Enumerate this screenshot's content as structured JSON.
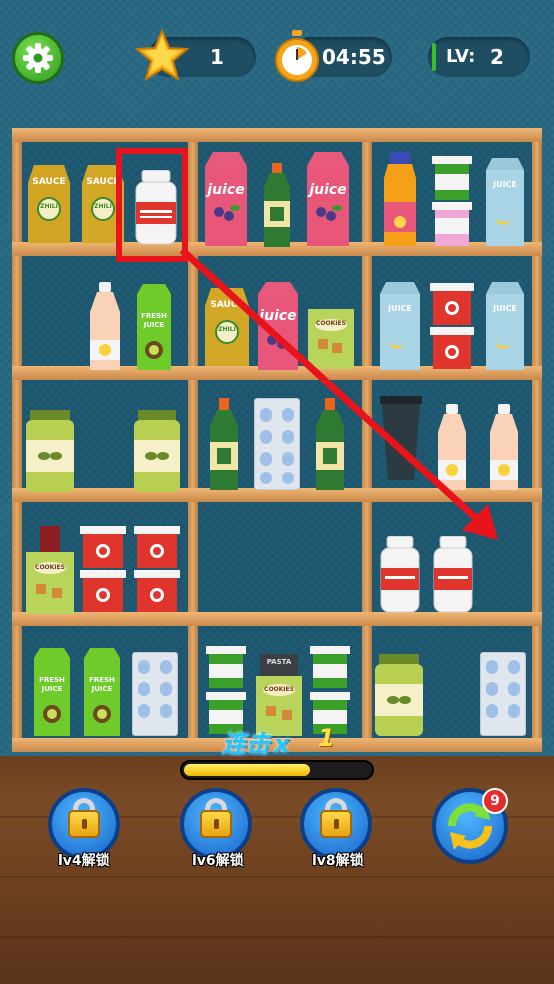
{
  "hud": {
    "stars": "1",
    "timer": "04:55",
    "level_label": "LV:",
    "level_value": "2"
  },
  "products": {
    "sauce": "SAUCE",
    "sauce_badge": "ZHILI",
    "juice": "juice",
    "juice_upper": "JUICE",
    "fresh_juice": "FRESH JUICE",
    "cookies": "COOKIES",
    "pasta": "PASTA"
  },
  "combo": {
    "label": "连击",
    "x": "x",
    "value": "1",
    "progress": 0.68
  },
  "unlock_buttons": [
    {
      "label": "lv4解锁"
    },
    {
      "label": "lv6解锁"
    },
    {
      "label": "lv8解锁"
    }
  ],
  "refresh": {
    "count": "9"
  },
  "hint": {
    "color": "#e8141b"
  }
}
